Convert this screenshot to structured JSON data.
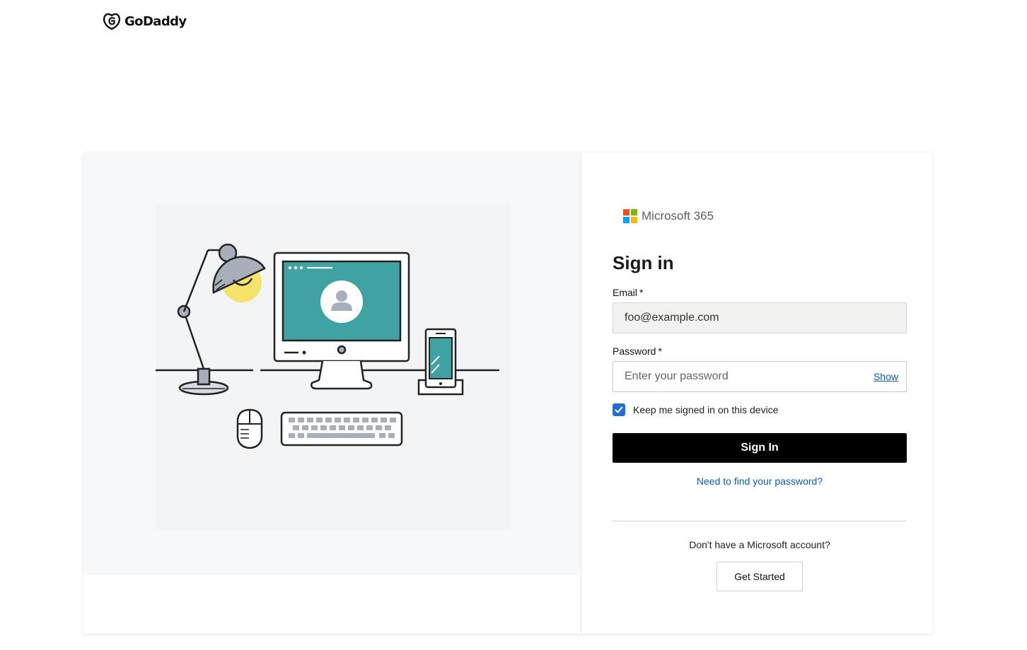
{
  "header": {
    "brand_name": "GoDaddy",
    "logo_icon": "godaddy-logo-icon"
  },
  "illustration": {
    "description_icons": [
      "desk-lamp-icon",
      "monitor-icon",
      "user-avatar-icon",
      "phone-icon",
      "mouse-icon",
      "keyboard-icon"
    ],
    "colors": {
      "screen": "#3fa3a3",
      "lamp_light": "#f5e36b",
      "lamp_shade": "#a7b0ba",
      "outline": "#222222"
    }
  },
  "signin": {
    "product_name": "Microsoft 365",
    "ms_logo_colors": [
      "#f25022",
      "#7fba00",
      "#00a4ef",
      "#ffb900"
    ],
    "title": "Sign in",
    "email_label": "Email",
    "email_required": "*",
    "email_value": "foo@example.com",
    "password_label": "Password",
    "password_required": "*",
    "password_placeholder": "Enter your password",
    "show_label": "Show",
    "keep_signed_in_label": "Keep me signed in on this device",
    "keep_signed_in_checked": true,
    "submit_label": "Sign In",
    "forgot_label": "Need to find your password?",
    "no_account_text": "Don't have a Microsoft account?",
    "get_started_label": "Get Started",
    "colors": {
      "link": "#0b5cab",
      "button": "#000000",
      "checkbox": "#1f6fd6"
    }
  }
}
